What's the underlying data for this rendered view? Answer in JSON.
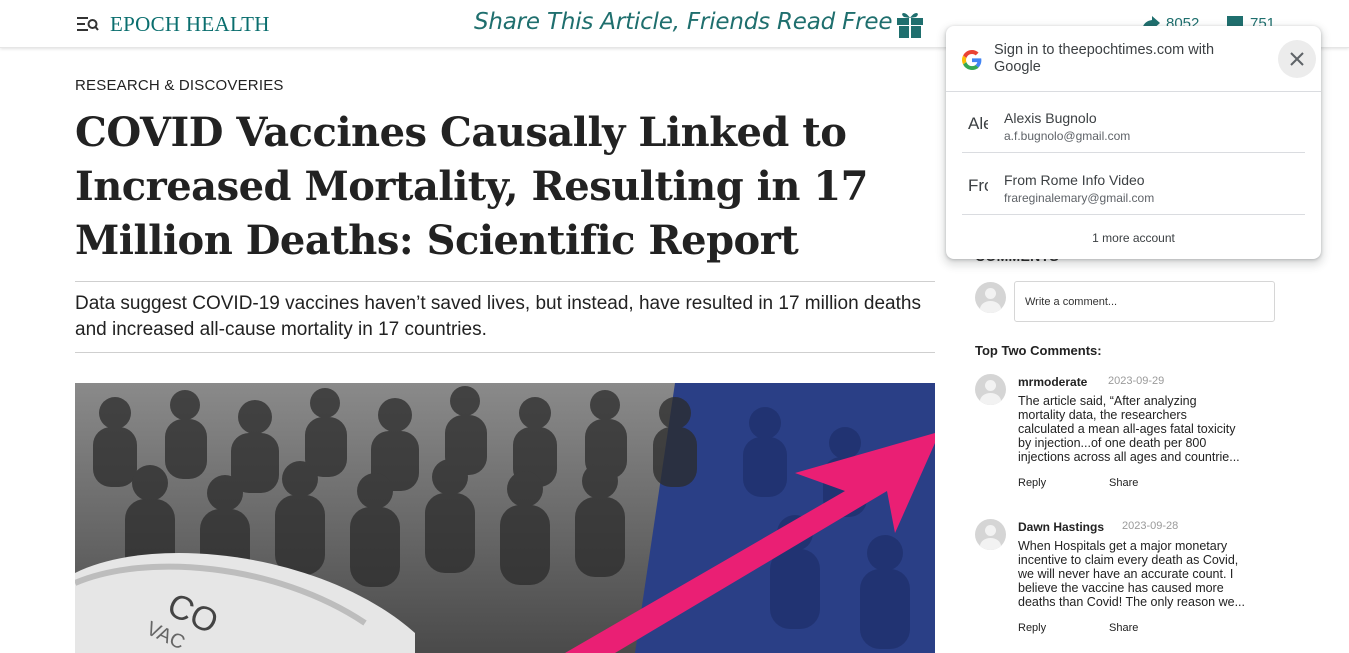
{
  "header": {
    "brand": "EPOCH HEALTH",
    "share_banner": "Share This Article, Friends Read Free",
    "share_count": "8052",
    "comment_count": "751",
    "accent_color": "#1f6f6e"
  },
  "article": {
    "category": "RESEARCH & DISCOVERIES",
    "headline": "COVID Vaccines Causally Linked to Increased Mortality, Resulting in 17 Million Deaths: Scientific Report",
    "subheadline": "Data suggest COVID-19 vaccines haven’t saved lives, but instead, have resulted in 17 million deaths and increased all-cause mortality in 17 countries.",
    "hero_vial_text": "CO\nVAC"
  },
  "comments": {
    "heading": "COMMENTS",
    "input_placeholder": "Write a comment...",
    "top_heading": "Top Two Comments:",
    "items": [
      {
        "author": "mrmoderate",
        "date": "2023-09-29",
        "text": "The article said, “After analyzing mortality data, the researchers calculated a mean all-ages fatal toxicity by injection...of one death per 800 injections across all ages and countrie...",
        "reply": "Reply",
        "share": "Share"
      },
      {
        "author": "Dawn Hastings",
        "date": "2023-09-28",
        "text": "When Hospitals get a major monetary incentive to claim every death as Covid, we will never have an accurate count. I believe the vaccine has caused more deaths than Covid! The only reason we...",
        "reply": "Reply",
        "share": "Share"
      }
    ]
  },
  "google_popup": {
    "title": "Sign in to theepochtimes.com with Google",
    "accounts": [
      {
        "initial": "Ale",
        "name": "Alexis Bugnolo",
        "email": "a.f.bugnolo@gmail.com"
      },
      {
        "initial": "Fro",
        "name": "From Rome Info Video",
        "email": "frareginalemary@gmail.com"
      }
    ],
    "more": "1 more account"
  }
}
